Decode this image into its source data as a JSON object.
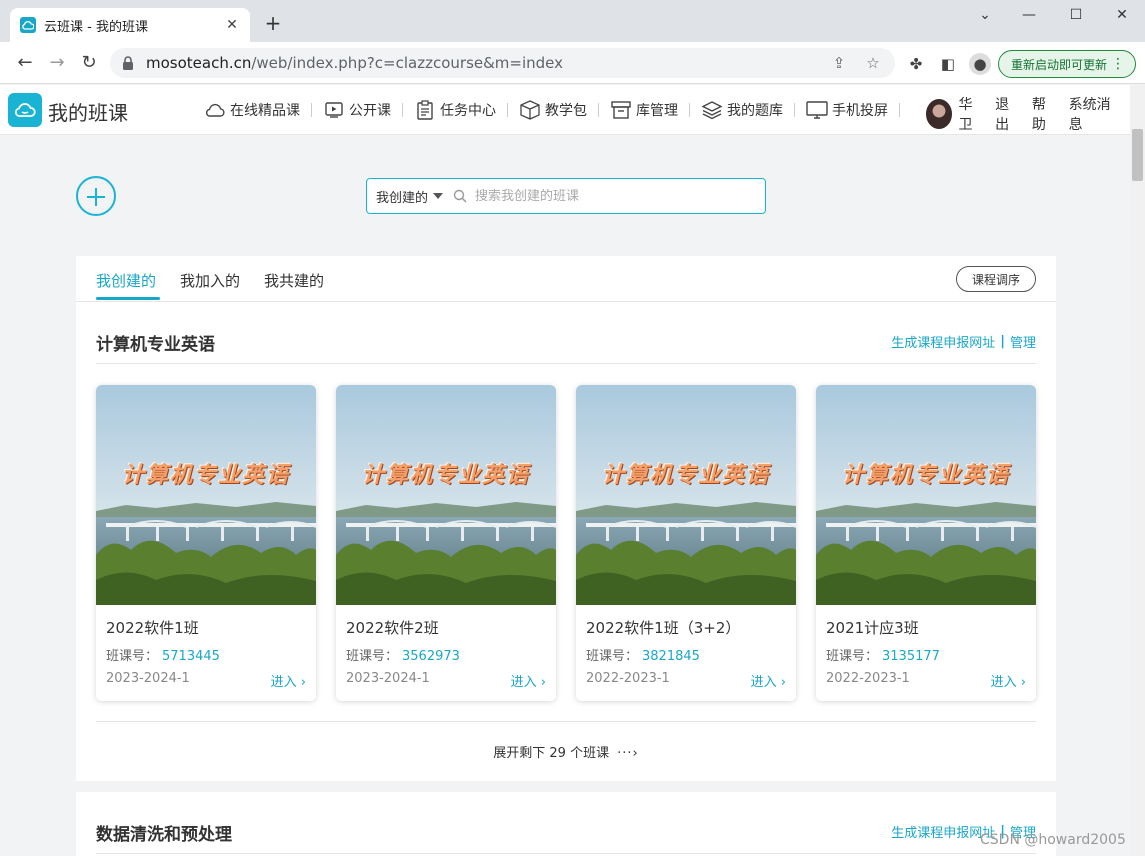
{
  "browser": {
    "tab_title": "云班课 - 我的班课",
    "url_host": "mosoteach.cn",
    "url_path": "/web/index.php?c=clazzcourse&m=index",
    "update_label": "重新启动即可更新"
  },
  "header": {
    "site_title": "我的班课",
    "nav": [
      {
        "label": "在线精品课",
        "icon": "cloud-icon"
      },
      {
        "label": "公开课",
        "icon": "play-icon"
      },
      {
        "label": "任务中心",
        "icon": "clipboard-icon"
      },
      {
        "label": "教学包",
        "icon": "package-icon"
      },
      {
        "label": "库管理",
        "icon": "archive-icon"
      },
      {
        "label": "我的题库",
        "icon": "layers-icon"
      },
      {
        "label": "手机投屏",
        "icon": "screen-icon"
      }
    ],
    "user_name": "华卫",
    "logout": "退出",
    "help": "帮助",
    "messages": "系统消息"
  },
  "search": {
    "scope": "我创建的",
    "placeholder": "搜索我创建的班课"
  },
  "tabs": {
    "created": "我创建的",
    "joined": "我加入的",
    "co_built": "我共建的",
    "order_button": "课程调序"
  },
  "courses": [
    {
      "name": "计算机专业英语",
      "link_report": "生成课程申报网址",
      "link_manage": "管理",
      "cover_text": "计算机专业英语",
      "classes": [
        {
          "name": "2022软件1班",
          "code": "5713445",
          "term": "2023-2024-1"
        },
        {
          "name": "2022软件2班",
          "code": "3562973",
          "term": "2023-2024-1"
        },
        {
          "name": "2022软件1班（3+2）",
          "code": "3821845",
          "term": "2022-2023-1"
        },
        {
          "name": "2021计应3班",
          "code": "3135177",
          "term": "2022-2023-1"
        }
      ],
      "expand_label": "展开剩下 29 个班课"
    },
    {
      "name": "数据清洗和预处理",
      "link_report": "生成课程申报网址",
      "link_manage": "管理"
    }
  ],
  "labels": {
    "class_code": "班课号：",
    "enter": "进入 ›",
    "more_dots": "···›"
  },
  "watermark": "CSDN @howard2005",
  "colors": {
    "accent": "#19a7c9",
    "update_green": "#137333"
  }
}
